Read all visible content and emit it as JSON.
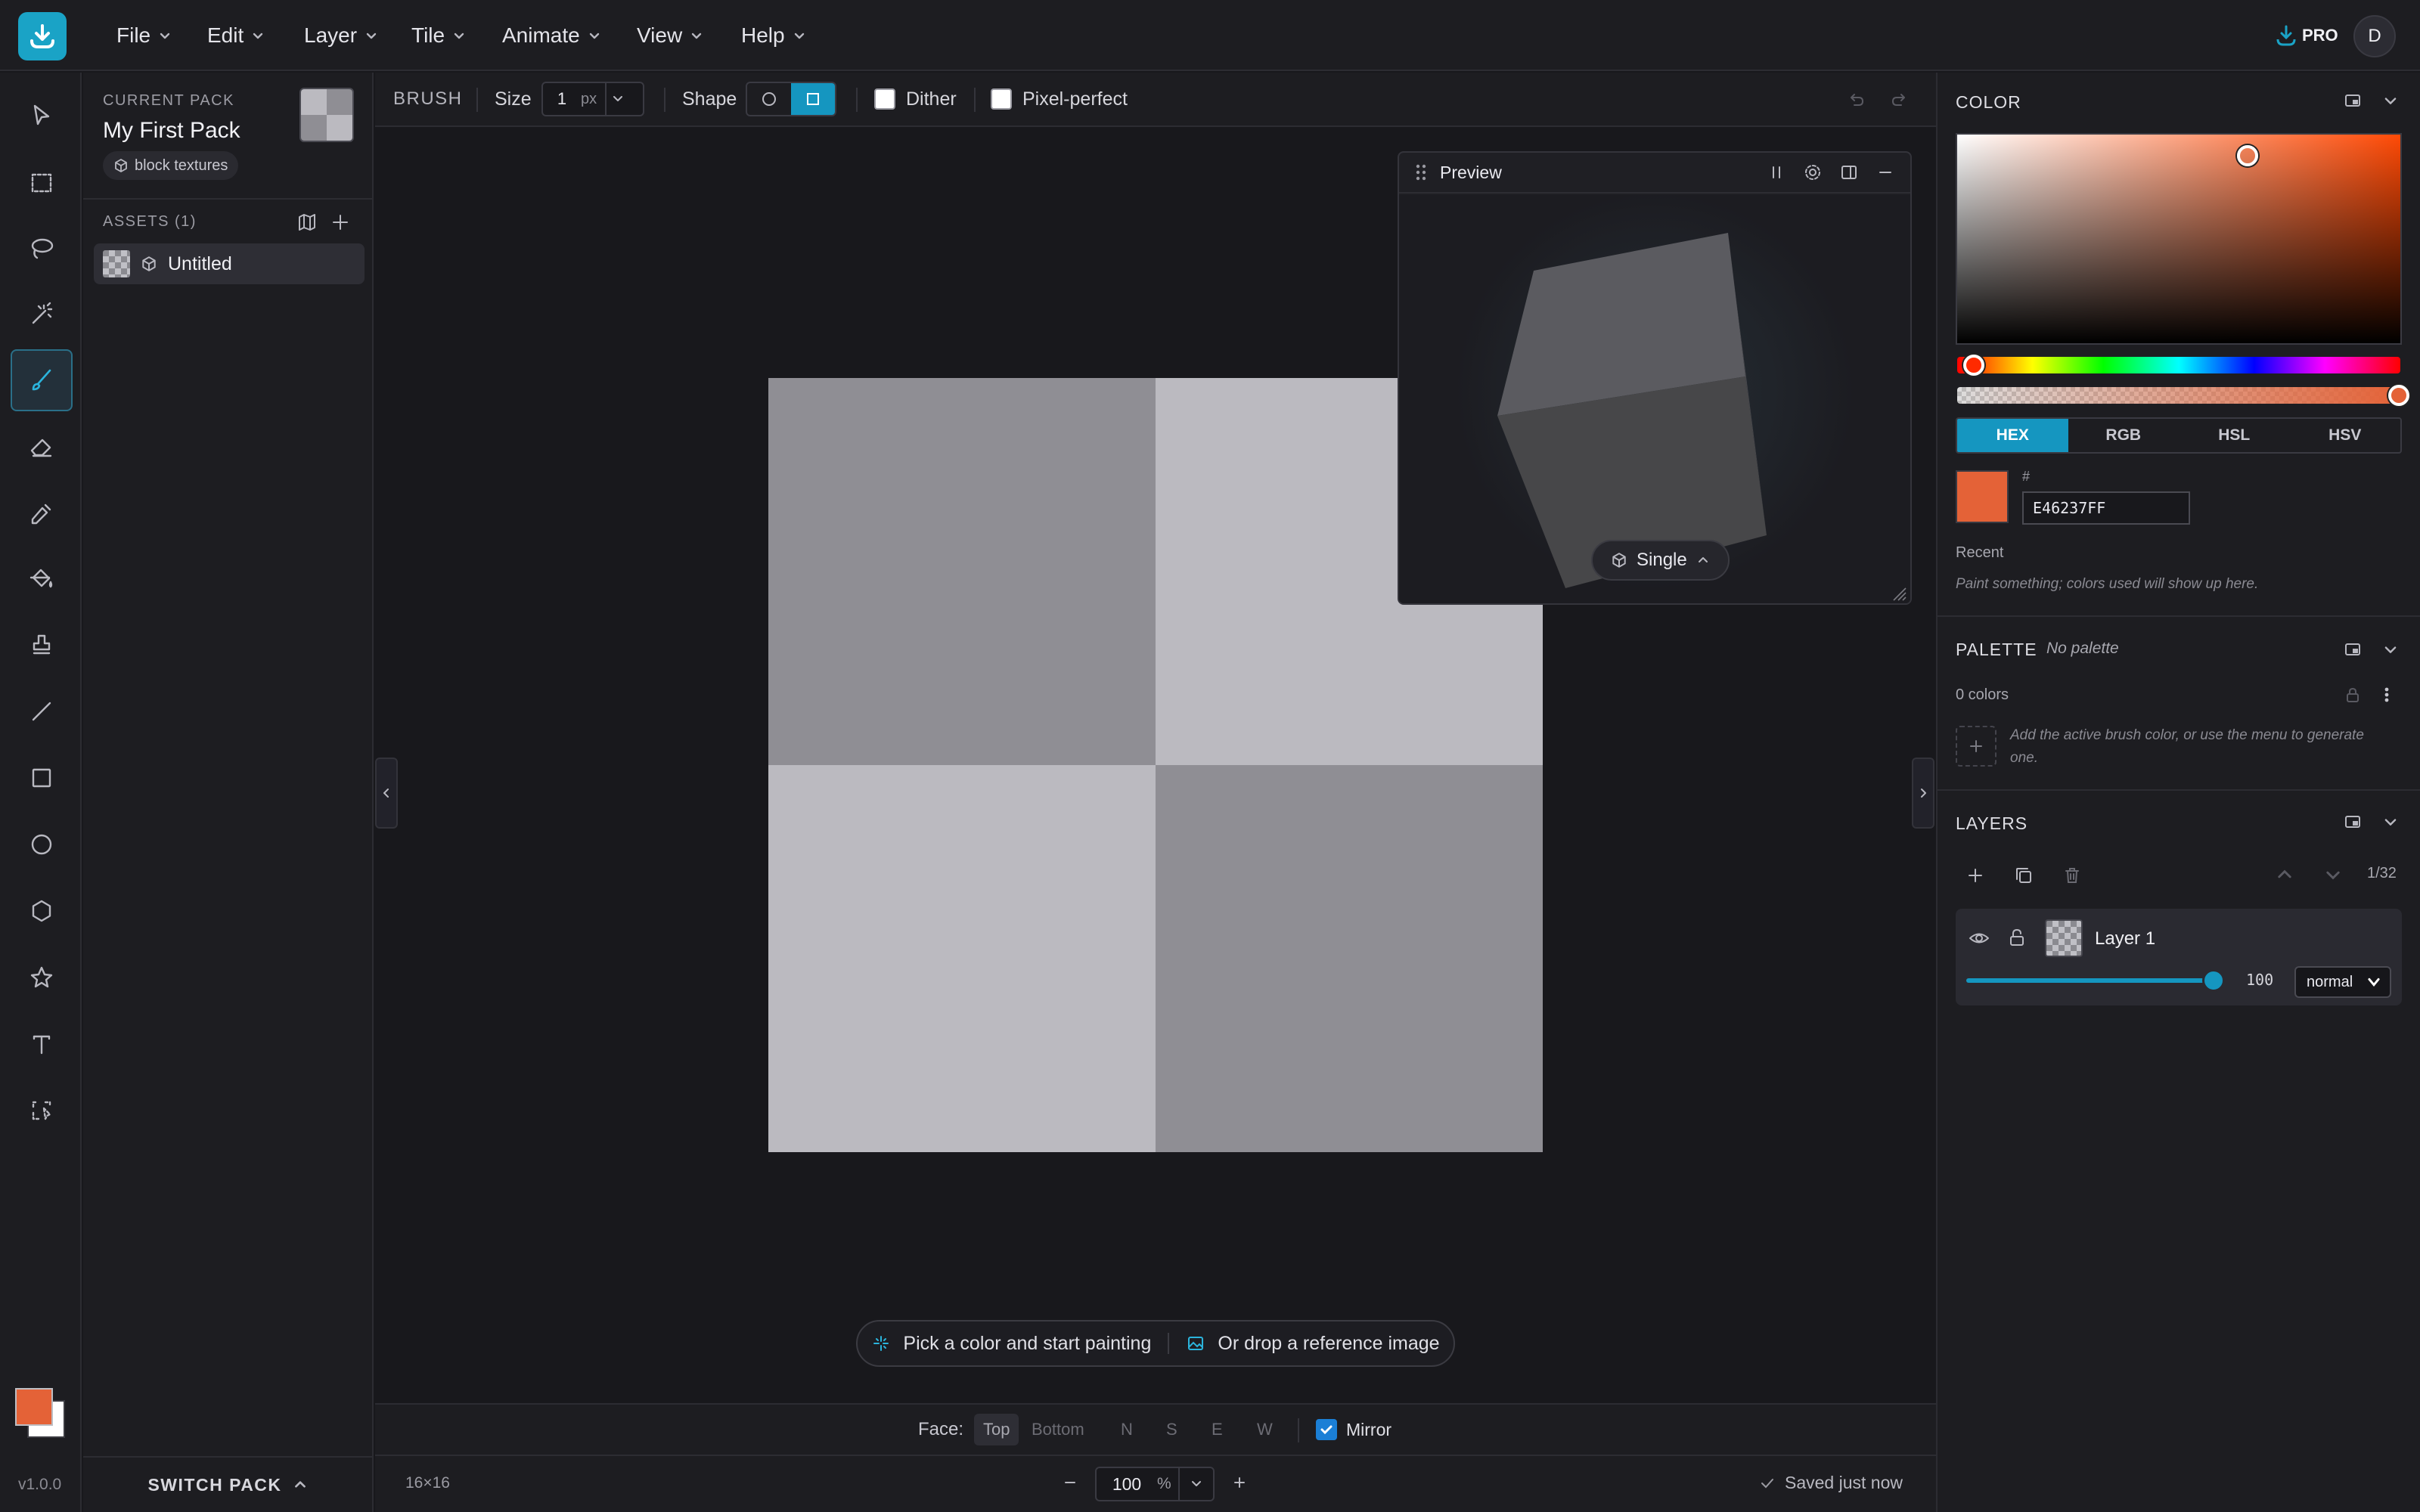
{
  "menu": [
    "File",
    "Edit",
    "Layer",
    "Tile",
    "Animate",
    "View",
    "Help"
  ],
  "account": {
    "pro_label": "PRO",
    "avatar_letter": "D"
  },
  "tools": [
    "select",
    "marquee",
    "lasso",
    "magic-wand",
    "brush",
    "eraser",
    "eyedropper",
    "fill",
    "stamp",
    "line",
    "rectangle",
    "ellipse",
    "polygon",
    "star",
    "text",
    "transform"
  ],
  "active_tool": "brush",
  "colors": {
    "primary": "#E46237",
    "secondary": "#FFFFFF",
    "accent": "#1596C0"
  },
  "version": "v1.0.0",
  "pack": {
    "section_label": "CURRENT PACK",
    "name": "My First Pack",
    "tag": "block textures",
    "assets_label": "ASSETS (1)",
    "assets": [
      {
        "name": "Untitled"
      }
    ],
    "switch_label": "SWITCH PACK"
  },
  "brush_bar": {
    "title": "BRUSH",
    "size_label": "Size",
    "size_value": "1",
    "size_unit": "px",
    "shape_label": "Shape",
    "dither_label": "Dither",
    "dither_checked": false,
    "pixel_perfect_label": "Pixel-perfect",
    "pixel_perfect_checked": false
  },
  "preview": {
    "title": "Preview",
    "mode_label": "Single"
  },
  "hint": {
    "paint": "Pick a color and start painting",
    "reference": "Or drop a reference image"
  },
  "face_bar": {
    "label": "Face:",
    "faces": [
      "Top",
      "Bottom",
      "N",
      "S",
      "E",
      "W"
    ],
    "active_face": "Top",
    "mirror_label": "Mirror",
    "mirror_checked": true
  },
  "status": {
    "dimensions": "16×16",
    "zoom": "100",
    "zoom_unit": "%",
    "saved": "Saved just now"
  },
  "color_panel": {
    "title": "COLOR",
    "modes": [
      "HEX",
      "RGB",
      "HSL",
      "HSV"
    ],
    "active_mode": "HEX",
    "hash": "#",
    "hex_value": "E46237FF",
    "recent_label": "Recent",
    "recent_empty": "Paint something; colors used will show up here."
  },
  "palette_panel": {
    "title": "PALETTE",
    "name": "No palette",
    "count": "0 colors",
    "empty_hint": "Add the active brush color, or use the menu to generate one."
  },
  "layers_panel": {
    "title": "LAYERS",
    "count": "1/32",
    "layers": [
      {
        "name": "Layer 1",
        "opacity": "100",
        "blend": "normal"
      }
    ]
  }
}
